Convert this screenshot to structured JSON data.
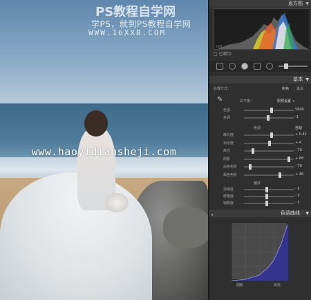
{
  "photo": {
    "watermark_line1": "PS教程自学网",
    "watermark_line2": "学PS，就到PS教程自学网",
    "watermark_line3": "WWW.16XX8.COM",
    "watermark_site": "www.haoyidiansheji.com"
  },
  "panel": {
    "histogram_title": "直方图",
    "histogram_labels": [
      "ISO",
      "",
      "",
      "",
      ""
    ],
    "histogram_checkbox": "已裁切",
    "basic": {
      "title": "基本",
      "treatment_label": "处理方式：",
      "treatment_color": "彩色",
      "treatment_bw": "黑白",
      "wb_label": "白平衡：",
      "wb_value": "原照设置 ÷",
      "sliders_wb": [
        {
          "label": "色温",
          "value": "5600",
          "pos": 0.55
        },
        {
          "label": "色调",
          "value": "-1",
          "pos": 0.49
        }
      ],
      "tone_label": "色调",
      "tone_auto": "自动",
      "sliders_tone": [
        {
          "label": "曝光度",
          "value": "+ 0.41",
          "pos": 0.56
        },
        {
          "label": "对比度",
          "value": "+ 4",
          "pos": 0.52
        },
        {
          "label": "高光",
          "value": "- 79",
          "pos": 0.18
        },
        {
          "label": "阴影",
          "value": "+ 88",
          "pos": 0.9
        },
        {
          "label": "白色色阶",
          "value": "- 79",
          "pos": 0.12
        },
        {
          "label": "黑色色阶",
          "value": "+ 46",
          "pos": 0.72
        }
      ],
      "presence_label": "偏好",
      "sliders_presence": [
        {
          "label": "清晰度",
          "value": "- 5",
          "pos": 0.46
        },
        {
          "label": "鲜艳度",
          "value": "- 5",
          "pos": 0.46
        },
        {
          "label": "饱和度",
          "value": "- 5",
          "pos": 0.46
        }
      ]
    },
    "curve": {
      "title": "色调曲线",
      "label_left": "阴影",
      "label_right": "高光"
    }
  },
  "colors": {
    "panel_bg": "#2f2f2f",
    "curve_line": "#3a3ab0"
  }
}
